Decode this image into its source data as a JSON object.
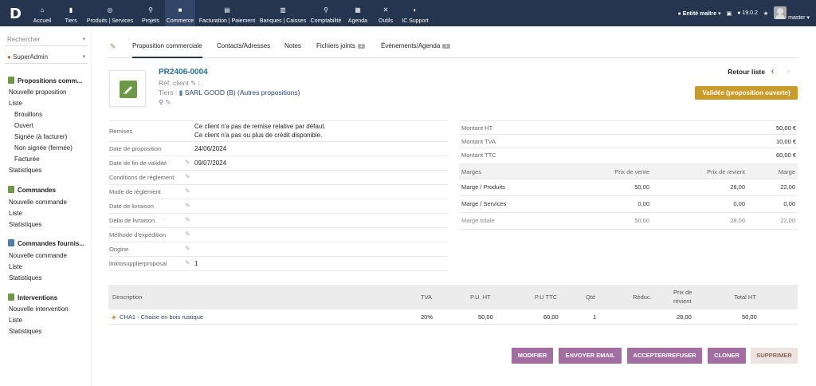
{
  "topbar": {
    "logo": "D",
    "menu": [
      {
        "icon": "home-icon",
        "glyph": "⌂",
        "label": "Accueil"
      },
      {
        "icon": "building-icon",
        "glyph": "▮",
        "label": "Tiers"
      },
      {
        "icon": "cube-icon",
        "glyph": "◎",
        "label": "Produits | Services"
      },
      {
        "icon": "project-icon",
        "glyph": "⚲",
        "label": "Projets"
      },
      {
        "icon": "suitcase-icon",
        "glyph": "■",
        "label": "Commerce"
      },
      {
        "icon": "invoice-icon",
        "glyph": "▤",
        "label": "Facturation | Paiement"
      },
      {
        "icon": "bank-icon",
        "glyph": "▥",
        "label": "Banques | Caisses"
      },
      {
        "icon": "magnifier-icon",
        "glyph": "⚲",
        "label": "Comptabilité"
      },
      {
        "icon": "calendar-icon",
        "glyph": "▦",
        "label": "Agenda"
      },
      {
        "icon": "tools-icon",
        "glyph": "✕",
        "label": "Outils"
      },
      {
        "icon": "support-icon",
        "glyph": "◐",
        "label": "IC Support"
      }
    ],
    "entity": "Entité maître",
    "version": "19.0.2",
    "user": "master"
  },
  "leftmenu": {
    "search_placeholder": "Rechercher",
    "user_select": "SuperAdmin",
    "sections": [
      {
        "title": "Propositions comm...",
        "links": [
          "Nouvelle proposition",
          "Liste"
        ],
        "sublinks": [
          "Brouillons",
          "Ouvert",
          "Signée (à facturer)",
          "Non signée (fermée)",
          "Facturée"
        ],
        "extra": [
          "Statistiques"
        ]
      },
      {
        "title": "Commandes",
        "links": [
          "Nouvelle commande",
          "Liste",
          "Statistiques"
        ]
      },
      {
        "title": "Commandes fournis...",
        "links": [
          "Nouvelle commande",
          "Liste",
          "Statistiques"
        ]
      },
      {
        "title": "Interventions",
        "links": [
          "Nouvelle intervention",
          "Liste",
          "Statistiques"
        ]
      }
    ]
  },
  "tabs": [
    {
      "label": "Proposition commerciale",
      "badge": ""
    },
    {
      "label": "Contacts/Adresses",
      "badge": ""
    },
    {
      "label": "Notes",
      "badge": ""
    },
    {
      "label": "Fichiers joints",
      "badge": "1"
    },
    {
      "label": "Événements/Agenda",
      "badge": "1"
    }
  ],
  "header": {
    "ref": "PR2406-0004",
    "ref_client_label": "Réf. client",
    "tiers_label": "Tiers :",
    "tiers_value": "SARL GOOD (B) (Autres propositions)",
    "back_label": "Retour liste",
    "prev_glyph": "‹",
    "next_glyph": "›",
    "status": "Validée (proposition ouverte)"
  },
  "fields": {
    "remises_label": "Remises",
    "remises_line1": "Ce client n'a pas de remise relative par défaut.",
    "remises_line2": "Ce client n'a pas ou plus de crédit disponible.",
    "rows": [
      {
        "label": "Date de proposition",
        "value": "24/06/2024",
        "pen": false
      },
      {
        "label": "Date de fin de validité",
        "value": "09/07/2024",
        "pen": true
      },
      {
        "label": "Conditions de règlement",
        "value": "",
        "pen": true
      },
      {
        "label": "Mode de règlement",
        "value": "",
        "pen": true
      },
      {
        "label": "Date de livraison",
        "value": "",
        "pen": true
      },
      {
        "label": "Délai de livraison",
        "value": "",
        "pen": true
      },
      {
        "label": "Méthode d'expédition",
        "value": "",
        "pen": true
      },
      {
        "label": "Origine",
        "value": "",
        "pen": true
      },
      {
        "label": "linktosupplierproposal",
        "value": "1",
        "pen": true
      }
    ]
  },
  "amounts": [
    {
      "label": "Montant HT",
      "value": "50,00 €"
    },
    {
      "label": "Montant TVA",
      "value": "10,00 €"
    },
    {
      "label": "Montant TTC",
      "value": "60,00 €"
    }
  ],
  "margins": {
    "headers": [
      "Marges",
      "Prix de vente",
      "Prix de revient",
      "Marge"
    ],
    "rows": [
      {
        "label": "Marge / Produits",
        "sale": "50,00",
        "cost": "28,00",
        "margin": "22,00"
      },
      {
        "label": "Marge / Services",
        "sale": "0,00",
        "cost": "0,00",
        "margin": "0,00"
      },
      {
        "label": "Marge totale",
        "sale": "50,00",
        "cost": "28,00",
        "margin": "22,00"
      }
    ]
  },
  "lines": {
    "headers": {
      "desc": "Description",
      "tva": "TVA",
      "puht": "P.U. HT",
      "puttc": "P.U TTC",
      "qty": "Qté",
      "reduc": "Réduc.",
      "cost1": "Prix de",
      "cost2": "revient",
      "total": "Total HT"
    },
    "row": {
      "desc": "CHA1 - Chaise en bois rustique",
      "tva": "20%",
      "puht": "50,00",
      "puttc": "60,00",
      "qty": "1",
      "reduc": "",
      "cost": "28,00",
      "total": "50,00"
    }
  },
  "buttons": {
    "modify": "MODIFIER",
    "email": "ENVOYER EMAIL",
    "accept": "ACCEPTER/REFUSER",
    "clone": "CLONER",
    "delete": "SUPPRIMER"
  },
  "colors": {
    "topbar": "#25354f",
    "accent": "#a26ea2",
    "status": "#c89b2a",
    "ref_link": "#2a6f8c"
  }
}
